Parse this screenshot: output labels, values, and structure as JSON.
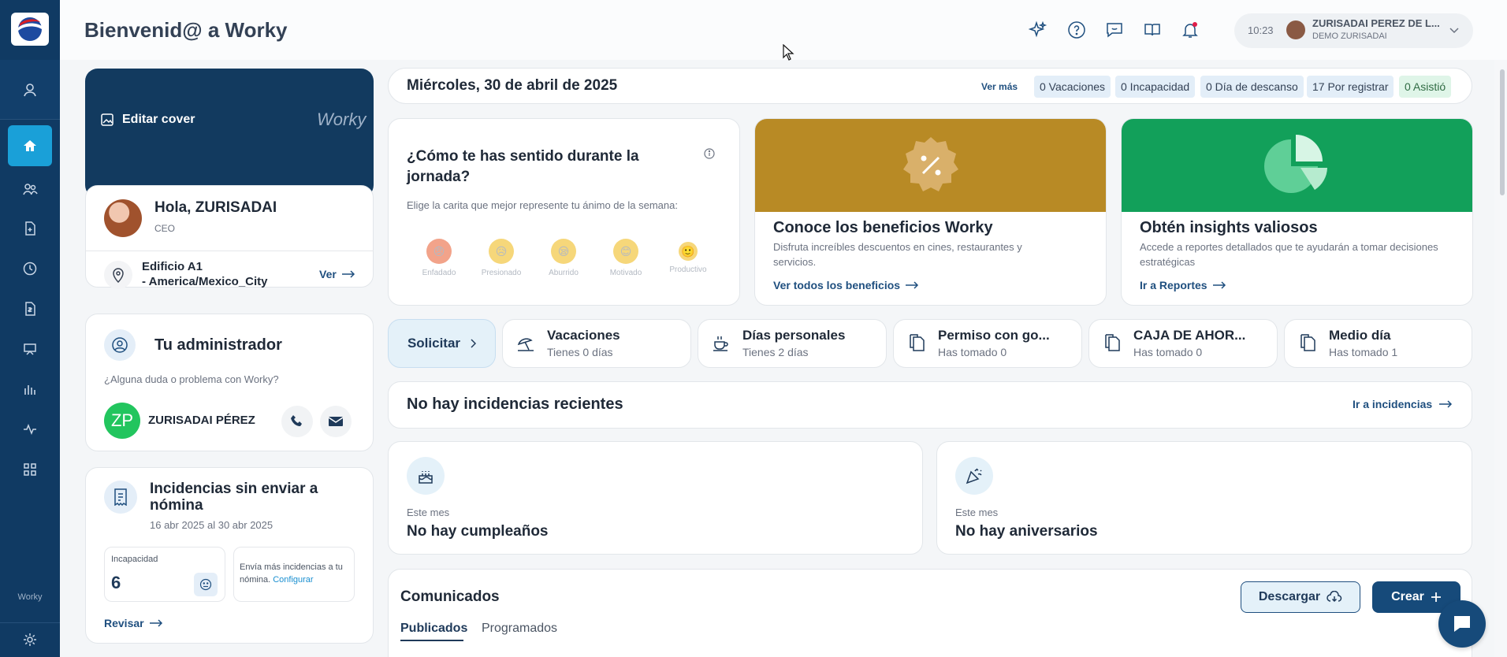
{
  "app": {
    "title": "Bienvenid@ a Worky",
    "sidebar_brand": "Worky"
  },
  "header": {
    "time": "10:23",
    "user_name": "ZURISADAI PEREZ DE L...",
    "company": "DEMO ZURISADAI"
  },
  "cover": {
    "edit_label": "Editar cover",
    "brand": "Worky"
  },
  "greeting": {
    "hello": "Hola, ZURISADAI",
    "role": "CEO",
    "location_line1": "Edificio A1",
    "location_line2": "- America/Mexico_City",
    "ver_label": "Ver"
  },
  "admin": {
    "title": "Tu administrador",
    "question": "¿Alguna duda o problema con Worky?",
    "initials": "ZP",
    "name": "ZURISADAI PÉREZ"
  },
  "incidencias_nomina": {
    "title": "Incidencias sin enviar a nómina",
    "range": "16 abr 2025 al 30 abr 2025",
    "incapacidad_label": "Incapacidad",
    "incapacidad_count": "6",
    "note": "Envía más incidencias a tu nómina.",
    "config_link": "Configurar",
    "revisar_label": "Revisar"
  },
  "date_bar": {
    "date": "Miércoles, 30 de abril de 2025",
    "ver_mas": "Ver más",
    "badges": [
      {
        "label": "0 Vacaciones"
      },
      {
        "label": "0 Incapacidad"
      },
      {
        "label": "0 Día de descanso"
      },
      {
        "label": "17 Por registrar"
      },
      {
        "label": "0 Asistió"
      }
    ]
  },
  "mood": {
    "title": "¿Cómo te has sentido durante la jornada?",
    "subtitle": "Elige la carita que mejor represente tu ánimo de la semana:",
    "options": [
      {
        "label": "Enfadado",
        "color": "#f2a38a"
      },
      {
        "label": "Presionado",
        "color": "#f6d77a"
      },
      {
        "label": "Aburrido",
        "color": "#f6d77a"
      },
      {
        "label": "Motivado",
        "color": "#f6d77a"
      },
      {
        "label": "Productivo",
        "color": "#f6d77a"
      }
    ]
  },
  "benefits": {
    "title": "Conoce los beneficios Worky",
    "desc": "Disfruta increíbles descuentos en cines, restaurantes y servicios.",
    "link": "Ver todos los beneficios",
    "color": "#b88a25"
  },
  "insights": {
    "title": "Obtén insights valiosos",
    "desc": "Accede a reportes detallados que te ayudarán a tomar decisiones estratégicas",
    "link": "Ir a Reportes",
    "color": "#12a05a"
  },
  "requests": {
    "solicitar_label": "Solicitar",
    "items": [
      {
        "title": "Vacaciones",
        "sub": "Tienes 0 días"
      },
      {
        "title": "Días personales",
        "sub": "Tienes 2 días"
      },
      {
        "title": "Permiso con go...",
        "sub": "Has tomado 0"
      },
      {
        "title": "CAJA DE AHOR...",
        "sub": "Has tomado 0"
      },
      {
        "title": "Medio día",
        "sub": "Has tomado 1"
      }
    ]
  },
  "incidencias": {
    "title": "No hay incidencias recientes",
    "link": "Ir a incidencias"
  },
  "birthdays": {
    "month_label": "Este mes",
    "text": "No hay cumpleaños"
  },
  "anniversaries": {
    "month_label": "Este mes",
    "text": "No hay aniversarios"
  },
  "comunicados": {
    "title": "Comunicados",
    "download_label": "Descargar",
    "create_label": "Crear",
    "tabs": [
      {
        "label": "Publicados",
        "active": true
      },
      {
        "label": "Programados",
        "active": false
      }
    ]
  }
}
